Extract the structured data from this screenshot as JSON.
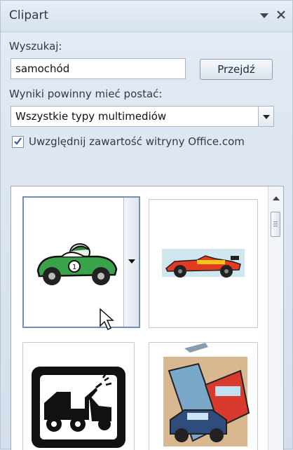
{
  "pane": {
    "title": "Clipart",
    "menu_icon": "dropdown-triangle",
    "close_icon": "close-x"
  },
  "search": {
    "label": "Wyszukaj:",
    "value": "samochód",
    "go_button": "Przejdź"
  },
  "results_type": {
    "label": "Wyniki powinny mieć postać:",
    "selected": "Wszystkie typy multimediów"
  },
  "include_office_com": {
    "label": "Uwzględnij zawartość witryny Office.com",
    "checked": true
  },
  "results": [
    {
      "name": "green-race-car-clipart",
      "selected": true
    },
    {
      "name": "formula-one-car-clipart",
      "selected": false
    },
    {
      "name": "tow-truck-clipart",
      "selected": false
    },
    {
      "name": "traffic-cars-collage-clipart",
      "selected": false
    }
  ]
}
